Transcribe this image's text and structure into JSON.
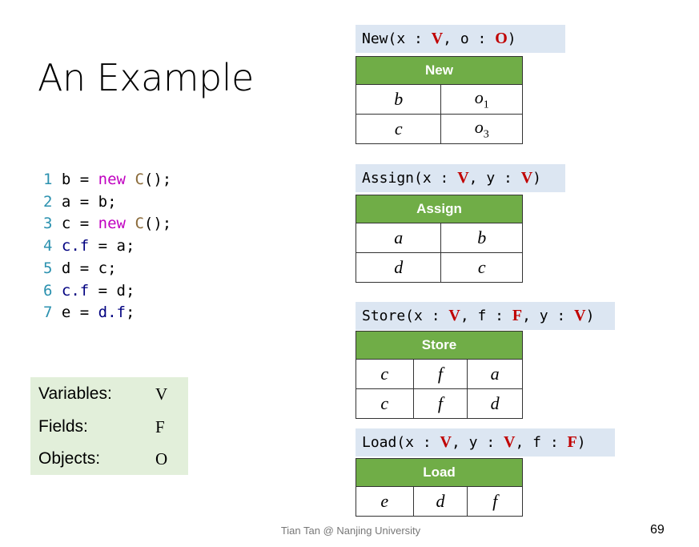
{
  "title": "An Example",
  "code": [
    {
      "n": "1",
      "parts": [
        [
          "b = ",
          ""
        ],
        [
          "new",
          "kw"
        ],
        [
          " ",
          ""
        ],
        [
          "C",
          "cls"
        ],
        [
          "();",
          ""
        ]
      ]
    },
    {
      "n": "2",
      "parts": [
        [
          "a = b;",
          ""
        ]
      ]
    },
    {
      "n": "3",
      "parts": [
        [
          "c = ",
          ""
        ],
        [
          "new",
          "kw"
        ],
        [
          " ",
          ""
        ],
        [
          "C",
          "cls"
        ],
        [
          "();",
          ""
        ]
      ]
    },
    {
      "n": "4",
      "parts": [
        [
          "c.f",
          "fld"
        ],
        [
          " = a;",
          ""
        ]
      ]
    },
    {
      "n": "5",
      "parts": [
        [
          "d = c;",
          ""
        ]
      ]
    },
    {
      "n": "6",
      "parts": [
        [
          "c.f",
          "fld"
        ],
        [
          " = d;",
          ""
        ]
      ]
    },
    {
      "n": "7",
      "parts": [
        [
          "e = ",
          ""
        ],
        [
          "d.f",
          "fld"
        ],
        [
          ";",
          ""
        ]
      ]
    }
  ],
  "legend": [
    {
      "label": "Variables:",
      "value": "V"
    },
    {
      "label": "Fields:",
      "value": "F"
    },
    {
      "label": "Objects:",
      "value": "O"
    }
  ],
  "relations": [
    {
      "signature": [
        [
          "New(x : ",
          ""
        ],
        [
          "V",
          "t"
        ],
        [
          ", o : ",
          ""
        ],
        [
          "O",
          "t"
        ],
        [
          ")",
          ""
        ]
      ],
      "header": "New",
      "rows": [
        [
          "b",
          [
            "o",
            "1"
          ]
        ],
        [
          "c",
          [
            "o",
            "3"
          ]
        ]
      ]
    },
    {
      "signature": [
        [
          "Assign(x : ",
          ""
        ],
        [
          "V",
          "t"
        ],
        [
          ", y : ",
          ""
        ],
        [
          "V",
          "t"
        ],
        [
          ")",
          ""
        ]
      ],
      "header": "Assign",
      "rows": [
        [
          "a",
          "b"
        ],
        [
          "d",
          "c"
        ]
      ]
    },
    {
      "signature": [
        [
          "Store(x : ",
          ""
        ],
        [
          "V",
          "t"
        ],
        [
          ", f : ",
          ""
        ],
        [
          "F",
          "t"
        ],
        [
          ", y : ",
          ""
        ],
        [
          "V",
          "t"
        ],
        [
          ")",
          ""
        ]
      ],
      "header": "Store",
      "rows": [
        [
          "c",
          "f",
          "a"
        ],
        [
          "c",
          "f",
          "d"
        ]
      ]
    },
    {
      "signature": [
        [
          "Load(x : ",
          ""
        ],
        [
          "V",
          "t"
        ],
        [
          ", y : ",
          ""
        ],
        [
          "V",
          "t"
        ],
        [
          ", f : ",
          ""
        ],
        [
          "F",
          "t"
        ],
        [
          ")",
          ""
        ]
      ],
      "header": "Load",
      "rows": [
        [
          "e",
          "d",
          "f"
        ]
      ]
    }
  ],
  "footer": "Tian Tan @ Nanjing University",
  "page_number": "69",
  "colors": {
    "header_green": "#70ad47",
    "signature_bg": "#dce6f2",
    "legend_bg": "#e2efda",
    "type_red": "#c00000",
    "keyword": "#c000c0"
  }
}
